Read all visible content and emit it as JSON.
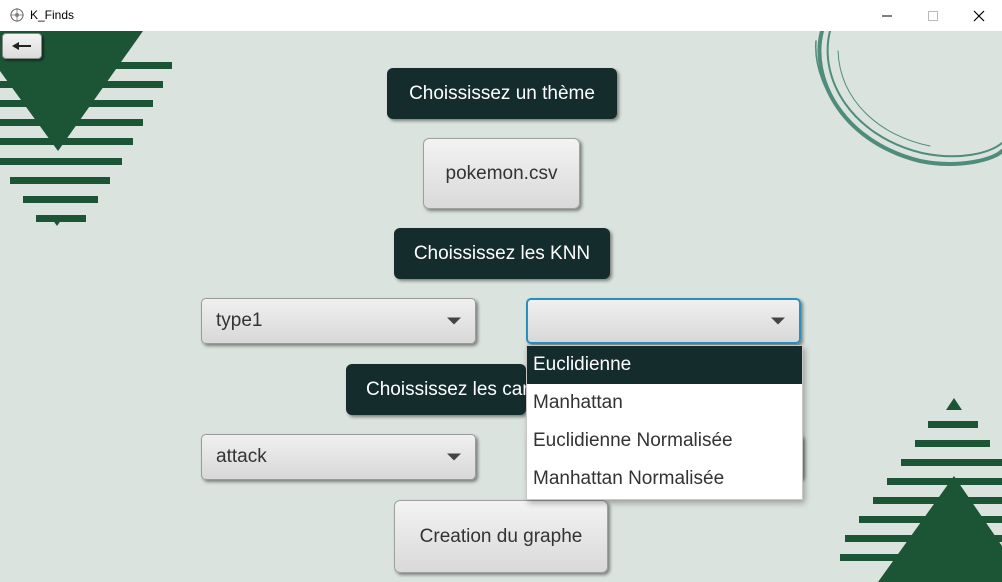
{
  "window": {
    "title": "K_Finds"
  },
  "colors": {
    "background": "#dbe3de",
    "accent_dark": "#142c2c",
    "decor_green": "#1c5535",
    "decor_teal": "#4f8c7b"
  },
  "back_button": {
    "icon": "arrow-left-icon"
  },
  "theme_label": "Choississez un thème",
  "file_button": "pokemon.csv",
  "knn_label": "Choississez les KNN",
  "combo_left_top": {
    "value": "type1"
  },
  "combo_right_top": {
    "value": ""
  },
  "caracteristics_label": "Choississez les car",
  "combo_left_bottom": {
    "value": "attack"
  },
  "graph_button": "Creation du graphe",
  "distance_dropdown": {
    "options": [
      "Euclidienne",
      "Manhattan",
      "Euclidienne Normalisée",
      "Manhattan Normalisée"
    ],
    "selected_index": 0
  }
}
